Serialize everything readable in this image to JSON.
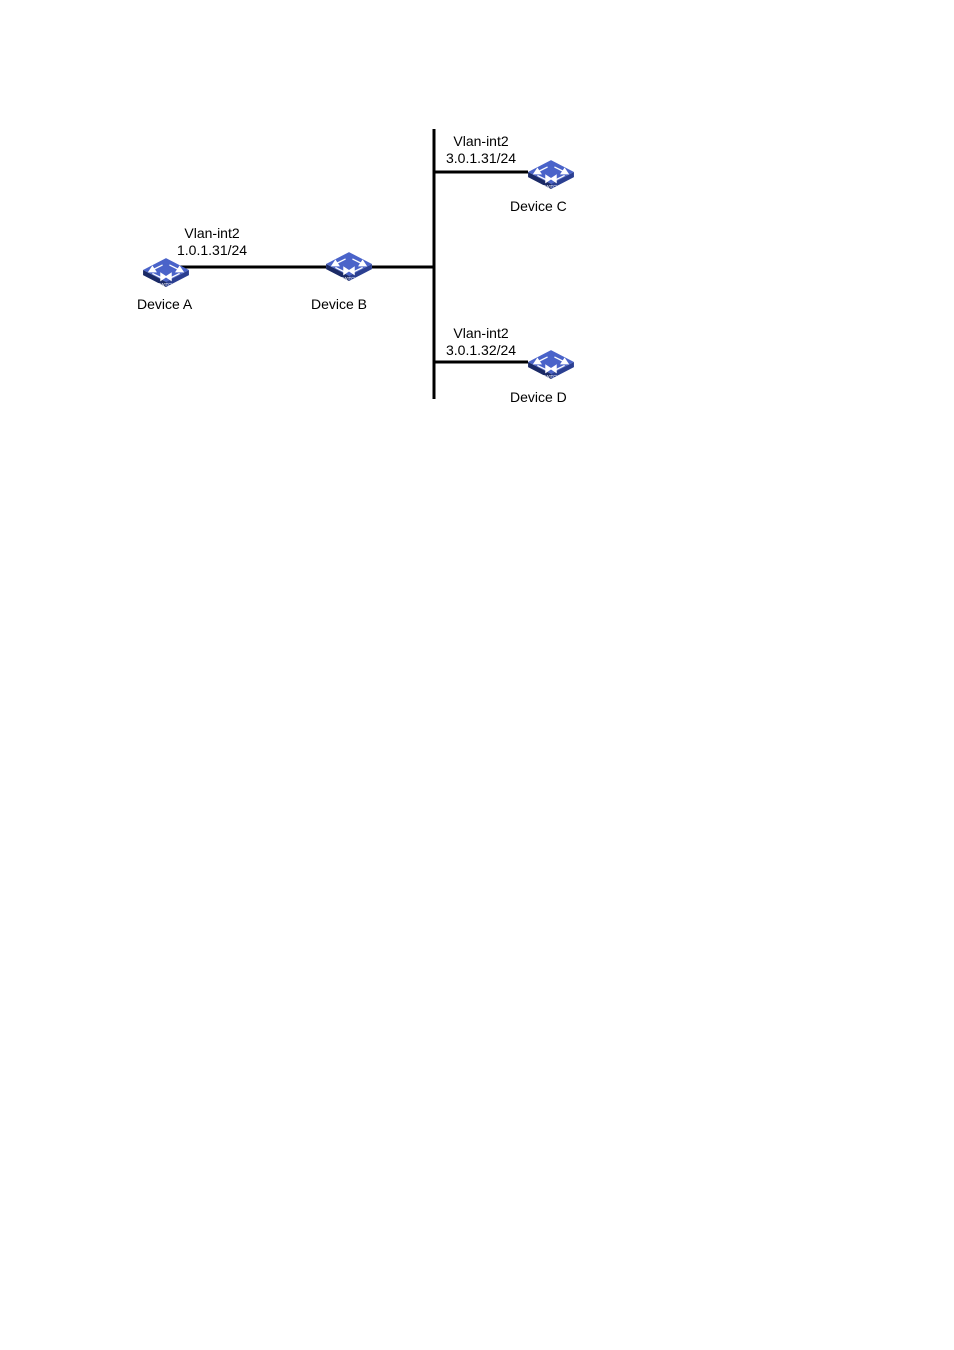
{
  "devices": {
    "a": {
      "name": "Device A",
      "interface_label": "Vlan-int2",
      "interface_ip": "1.0.1.31/24"
    },
    "b": {
      "name": "Device B"
    },
    "c": {
      "name": "Device C",
      "interface_label": "Vlan-int2",
      "interface_ip": "3.0.1.31/24"
    },
    "d": {
      "name": "Device D",
      "interface_label": "Vlan-int2",
      "interface_ip": "3.0.1.32/24"
    }
  },
  "layout": {
    "switch_color": "#2b3f91",
    "switch_top": "#4a63c9",
    "switch_bottom": "#1b2a66"
  }
}
